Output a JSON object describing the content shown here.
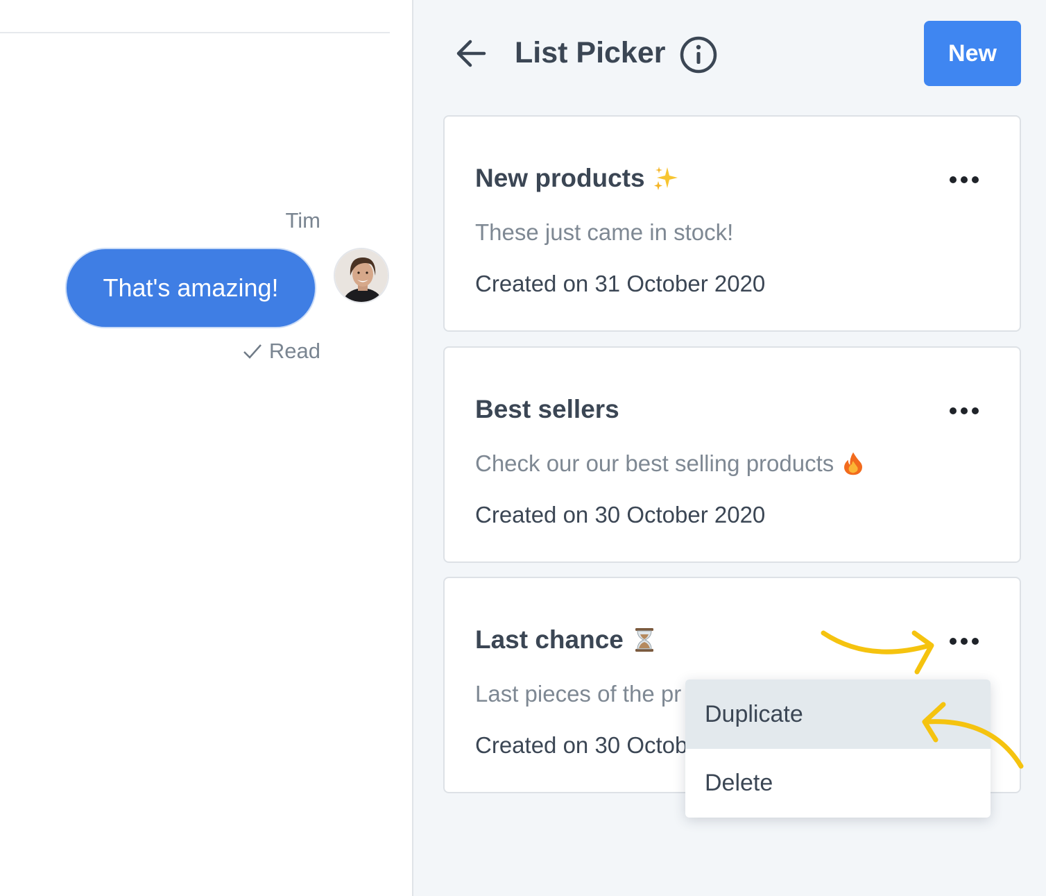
{
  "chat": {
    "sender": "Tim",
    "message": "That's amazing!",
    "status": "Read"
  },
  "panel": {
    "title": "List Picker",
    "new_button": "New",
    "lists": [
      {
        "title": "New products",
        "title_icon": "sparkles-icon",
        "description": "These just came in stock!",
        "description_icon": "",
        "created": "Created on 31 October 2020"
      },
      {
        "title": "Best sellers",
        "title_icon": "",
        "description": "Check our our best selling products",
        "description_icon": "fire-icon",
        "created": "Created on 30 October 2020"
      },
      {
        "title": "Last chance",
        "title_icon": "hourglass-icon",
        "description": "Last pieces of the pr",
        "description_icon": "",
        "created": "Created on 30 Octob"
      }
    ],
    "menu": {
      "items": [
        "Duplicate",
        "Delete"
      ],
      "highlighted": "Duplicate"
    }
  },
  "colors": {
    "accent": "#3f86f1",
    "bubble": "#3f7ee4",
    "panel_bg": "#f3f6f9",
    "annotation": "#f5c30f",
    "text_dark": "#3b4654",
    "text_muted": "#7e8893"
  }
}
